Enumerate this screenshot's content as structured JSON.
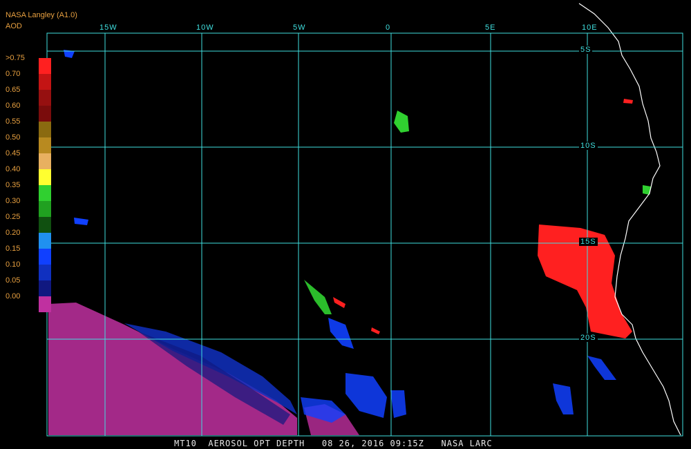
{
  "header": {
    "line1": "NASA Langley (A1.0)",
    "line2": "AOD"
  },
  "legend": {
    "labels": [
      ">0.75",
      "0.70",
      "0.65",
      "0.60",
      "0.55",
      "0.50",
      "0.45",
      "0.40",
      "0.35",
      "0.30",
      "0.25",
      "0.20",
      "0.15",
      "0.10",
      "0.05",
      "0.00"
    ],
    "colors": [
      "#ff2020",
      "#c41414",
      "#961010",
      "#7a0c0c",
      "#8a6a10",
      "#b88a20",
      "#e8b060",
      "#ffff30",
      "#30d030",
      "#20a020",
      "#105010",
      "#2090f0",
      "#1040ff",
      "#1030c0",
      "#101880",
      "#c030a0"
    ]
  },
  "grid": {
    "lon_labels": [
      "15W",
      "10W",
      "5W",
      "0",
      "5E",
      "10E"
    ],
    "lat_labels": [
      "5S",
      "10S",
      "15S",
      "20S"
    ],
    "colors": {
      "grid": "#40e0e0",
      "coast": "#ffffff"
    }
  },
  "footer": "MT10  AEROSOL OPT DEPTH   08 26, 2016 09:15Z   NASA LARC"
}
